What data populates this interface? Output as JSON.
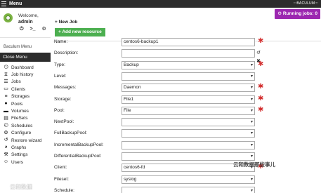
{
  "topbar": {
    "title": "Menu",
    "brand": ":::BACULUM:::"
  },
  "running_jobs": "Running jobs: 0",
  "user": {
    "welcome": "Welcome,",
    "name": "admin"
  },
  "sidebar": {
    "title": "Baculum Menu",
    "close_menu": "Close Menu",
    "items": [
      {
        "label": "Dashboard",
        "icon": "dashboard-icon",
        "glyph": "◷"
      },
      {
        "label": "Job history",
        "icon": "history-icon",
        "glyph": "⧖"
      },
      {
        "label": "Jobs",
        "icon": "jobs-icon",
        "glyph": "☰"
      },
      {
        "label": "Clients",
        "icon": "monitor-icon",
        "glyph": "▭"
      },
      {
        "label": "Storages",
        "icon": "database-icon",
        "glyph": "≡"
      },
      {
        "label": "Pools",
        "icon": "pools-icon",
        "glyph": "●"
      },
      {
        "label": "Volumes",
        "icon": "hdd-icon",
        "glyph": "▬"
      },
      {
        "label": "FileSets",
        "icon": "files-icon",
        "glyph": "▤"
      },
      {
        "label": "Schedules",
        "icon": "clock-icon",
        "glyph": "◴"
      },
      {
        "label": "Configure",
        "icon": "gear-icon",
        "glyph": "⚙"
      },
      {
        "label": "Restore wizard",
        "icon": "restore-icon",
        "glyph": "↺"
      },
      {
        "label": "Graphs",
        "icon": "chart-icon",
        "glyph": "◕"
      },
      {
        "label": "Settings",
        "icon": "wrench-icon",
        "glyph": "⚒"
      },
      {
        "label": "Users",
        "icon": "users-icon",
        "glyph": "☺"
      }
    ]
  },
  "main": {
    "new_job": "+ New Job",
    "add_resource": "+ Add new resource",
    "fields": [
      {
        "label": "Name:",
        "value": "centos6-backup1",
        "type": "text",
        "required": true
      },
      {
        "label": "Description:",
        "value": "",
        "type": "text",
        "required": false,
        "extra": "↺ ✖"
      },
      {
        "label": "Type:",
        "value": "Backup",
        "type": "select",
        "required": true
      },
      {
        "label": "Level:",
        "value": "",
        "type": "select",
        "required": false
      },
      {
        "label": "Messages:",
        "value": "Daemon",
        "type": "select",
        "required": true
      },
      {
        "label": "Storage:",
        "value": "File1",
        "type": "select",
        "required": true
      },
      {
        "label": "Pool:",
        "value": "File",
        "type": "select",
        "required": true
      },
      {
        "label": "NextPool:",
        "value": "",
        "type": "select",
        "required": false
      },
      {
        "label": "FullBackupPool:",
        "value": "",
        "type": "select",
        "required": false
      },
      {
        "label": "IncrementalBackupPool:",
        "value": "",
        "type": "select",
        "required": false
      },
      {
        "label": "DifferentialBackupPool:",
        "value": "",
        "type": "select",
        "required": false
      },
      {
        "label": "Client:",
        "value": "centos6-fd",
        "type": "select",
        "required": true
      },
      {
        "label": "Fileset:",
        "value": "syslog",
        "type": "select",
        "required": false
      },
      {
        "label": "Schedule:",
        "value": "",
        "type": "select",
        "required": false
      }
    ]
  },
  "watermark": "云和数据那些事儿",
  "watermark2": "云和数据"
}
